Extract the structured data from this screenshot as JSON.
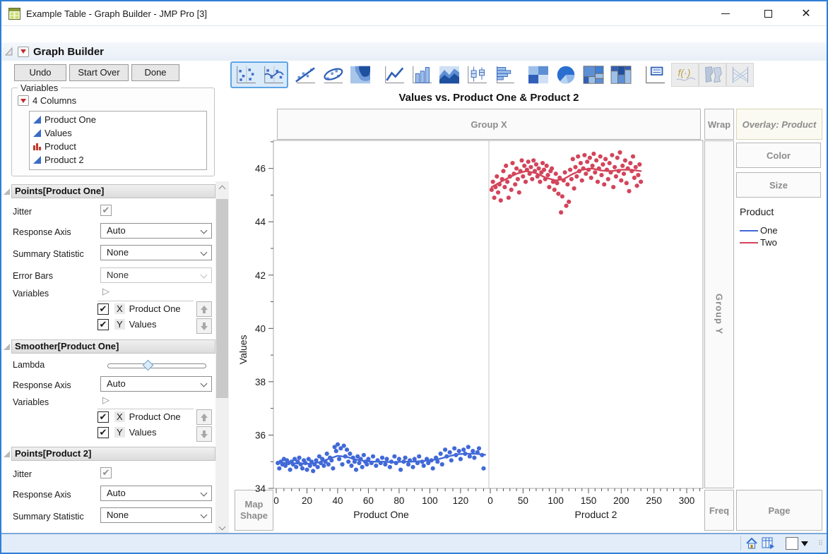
{
  "window": {
    "title": "Example Table - Graph Builder - JMP Pro [3]",
    "controls": [
      "minimize",
      "maximize",
      "close"
    ]
  },
  "header": {
    "title": "Graph Builder",
    "undo": "Undo",
    "start_over": "Start Over",
    "done": "Done"
  },
  "variables_panel": {
    "legend": "Variables",
    "columns_label": "4 Columns",
    "columns": [
      {
        "name": "Product One",
        "type": "continuous"
      },
      {
        "name": "Values",
        "type": "continuous"
      },
      {
        "name": "Product",
        "type": "nominal"
      },
      {
        "name": "Product 2",
        "type": "continuous"
      }
    ]
  },
  "sections": {
    "points_one": {
      "title": "Points[Product One]",
      "jitter_label": "Jitter",
      "response_axis_label": "Response Axis",
      "response_axis_value": "Auto",
      "summary_label": "Summary Statistic",
      "summary_value": "None",
      "error_bars_label": "Error Bars",
      "error_bars_value": "None",
      "variables_label": "Variables",
      "x_role": "X",
      "x_var": "Product One",
      "y_role": "Y",
      "y_var": "Values"
    },
    "smoother_one": {
      "title": "Smoother[Product One]",
      "lambda_label": "Lambda",
      "response_axis_label": "Response Axis",
      "response_axis_value": "Auto",
      "variables_label": "Variables",
      "x_role": "X",
      "x_var": "Product One",
      "y_role": "Y",
      "y_var": "Values"
    },
    "points_two": {
      "title": "Points[Product 2]",
      "jitter_label": "Jitter",
      "response_axis_label": "Response Axis",
      "response_axis_value": "Auto",
      "summary_label": "Summary Statistic",
      "summary_value": "None"
    }
  },
  "toolbar": {
    "icons": [
      {
        "name": "points-icon",
        "selected": true
      },
      {
        "name": "smoother-icon",
        "selected": true
      },
      {
        "name": "line-of-fit-icon"
      },
      {
        "name": "ellipse-icon"
      },
      {
        "name": "contour-icon"
      },
      {
        "name": "line-icon"
      },
      {
        "name": "bar-icon"
      },
      {
        "name": "area-icon"
      },
      {
        "name": "box-plot-icon"
      },
      {
        "name": "histogram-icon"
      },
      {
        "name": "heatmap-icon"
      },
      {
        "name": "pie-icon"
      },
      {
        "name": "treemap-icon"
      },
      {
        "name": "mosaic-icon"
      },
      {
        "name": "caption-box-icon"
      },
      {
        "name": "formula-icon",
        "disabled": true
      },
      {
        "name": "map-shapes-icon",
        "disabled": true
      },
      {
        "name": "parallel-plot-icon",
        "disabled": true
      }
    ]
  },
  "zones": {
    "group_x": "Group X",
    "wrap": "Wrap",
    "overlay": "Overlay: Product",
    "group_y": "Group Y",
    "color": "Color",
    "size": "Size",
    "freq": "Freq",
    "page": "Page",
    "map_shape": "Map Shape"
  },
  "status_bar": {
    "icons": [
      "home-icon",
      "data-table-icon",
      "drop-target-box",
      "dropdown-triangle",
      "resize-grip"
    ]
  },
  "chart_data": {
    "type": "scatter",
    "title": "Values vs. Product One & Product 2",
    "ylabel": "Values",
    "ylim": [
      34,
      47.05
    ],
    "yticks": [
      34,
      36,
      38,
      40,
      42,
      44,
      46
    ],
    "legend": {
      "title": "Product",
      "entries": [
        {
          "label": "One",
          "color": "#4169d8"
        },
        {
          "label": "Two",
          "color": "#d3455b"
        }
      ]
    },
    "panels": [
      {
        "xlabel": "Product One",
        "xlim": [
          0,
          138
        ],
        "xticks": [
          0,
          20,
          40,
          60,
          80,
          100,
          120
        ],
        "minor_step": 5,
        "series": "One",
        "color": "#4169d8",
        "points": [
          [
            1,
            34.95
          ],
          [
            2,
            34.75
          ],
          [
            3,
            35.0
          ],
          [
            4,
            34.9
          ],
          [
            5,
            35.1
          ],
          [
            6,
            34.85
          ],
          [
            7,
            35.05
          ],
          [
            8,
            34.95
          ],
          [
            9,
            34.7
          ],
          [
            10,
            35.0
          ],
          [
            11,
            34.9
          ],
          [
            12,
            35.1
          ],
          [
            13,
            34.8
          ],
          [
            14,
            35.0
          ],
          [
            15,
            35.15
          ],
          [
            16,
            34.9
          ],
          [
            17,
            34.75
          ],
          [
            18,
            35.05
          ],
          [
            19,
            34.95
          ],
          [
            20,
            34.7
          ],
          [
            21,
            35.1
          ],
          [
            22,
            34.85
          ],
          [
            23,
            35.0
          ],
          [
            24,
            34.65
          ],
          [
            25,
            34.9
          ],
          [
            26,
            35.05
          ],
          [
            27,
            34.8
          ],
          [
            28,
            35.2
          ],
          [
            29,
            34.95
          ],
          [
            30,
            35.1
          ],
          [
            31,
            34.85
          ],
          [
            32,
            35.0
          ],
          [
            33,
            35.3
          ],
          [
            34,
            34.9
          ],
          [
            35,
            35.15
          ],
          [
            36,
            35.05
          ],
          [
            37,
            34.75
          ],
          [
            38,
            35.55
          ],
          [
            39,
            35.4
          ],
          [
            40,
            35.65
          ],
          [
            41,
            35.1
          ],
          [
            42,
            35.5
          ],
          [
            43,
            34.9
          ],
          [
            44,
            35.6
          ],
          [
            45,
            35.2
          ],
          [
            46,
            35.45
          ],
          [
            47,
            35.0
          ],
          [
            48,
            35.3
          ],
          [
            49,
            34.85
          ],
          [
            50,
            35.15
          ],
          [
            51,
            35.0
          ],
          [
            52,
            34.7
          ],
          [
            53,
            35.2
          ],
          [
            54,
            34.95
          ],
          [
            55,
            35.1
          ],
          [
            56,
            34.8
          ],
          [
            57,
            35.25
          ],
          [
            58,
            35.0
          ],
          [
            59,
            34.9
          ],
          [
            60,
            35.1
          ],
          [
            62,
            34.95
          ],
          [
            63,
            35.2
          ],
          [
            65,
            34.85
          ],
          [
            66,
            35.05
          ],
          [
            68,
            34.95
          ],
          [
            69,
            35.15
          ],
          [
            71,
            34.9
          ],
          [
            72,
            35.1
          ],
          [
            74,
            34.8
          ],
          [
            75,
            35.0
          ],
          [
            77,
            35.2
          ],
          [
            78,
            34.95
          ],
          [
            80,
            35.1
          ],
          [
            81,
            34.7
          ],
          [
            83,
            35.0
          ],
          [
            84,
            35.15
          ],
          [
            86,
            34.9
          ],
          [
            87,
            35.05
          ],
          [
            89,
            34.8
          ],
          [
            90,
            35.1
          ],
          [
            92,
            34.95
          ],
          [
            93,
            35.2
          ],
          [
            95,
            35.0
          ],
          [
            96,
            34.85
          ],
          [
            98,
            35.1
          ],
          [
            99,
            34.95
          ],
          [
            101,
            35.05
          ],
          [
            102,
            34.75
          ],
          [
            104,
            35.15
          ],
          [
            105,
            35.0
          ],
          [
            107,
            35.3
          ],
          [
            108,
            34.9
          ],
          [
            110,
            35.45
          ],
          [
            111,
            35.2
          ],
          [
            113,
            35.35
          ],
          [
            114,
            35.05
          ],
          [
            116,
            35.5
          ],
          [
            117,
            35.25
          ],
          [
            119,
            35.4
          ],
          [
            120,
            35.1
          ],
          [
            122,
            35.45
          ],
          [
            123,
            35.3
          ],
          [
            125,
            35.55
          ],
          [
            126,
            35.2
          ],
          [
            128,
            35.4
          ],
          [
            129,
            35.15
          ],
          [
            131,
            35.35
          ],
          [
            132,
            35.5
          ],
          [
            134,
            35.25
          ],
          [
            135,
            34.75
          ]
        ],
        "smoother": [
          [
            1,
            34.97
          ],
          [
            8,
            34.95
          ],
          [
            15,
            34.93
          ],
          [
            22,
            34.92
          ],
          [
            28,
            34.98
          ],
          [
            34,
            35.1
          ],
          [
            40,
            35.22
          ],
          [
            46,
            35.18
          ],
          [
            52,
            35.08
          ],
          [
            58,
            35.02
          ],
          [
            64,
            35.0
          ],
          [
            70,
            35.0
          ],
          [
            76,
            34.98
          ],
          [
            82,
            35.0
          ],
          [
            88,
            35.0
          ],
          [
            94,
            35.02
          ],
          [
            100,
            35.05
          ],
          [
            106,
            35.1
          ],
          [
            112,
            35.2
          ],
          [
            118,
            35.28
          ],
          [
            124,
            35.3
          ],
          [
            130,
            35.3
          ],
          [
            136,
            35.26
          ]
        ]
      },
      {
        "xlabel": "Product 2",
        "xlim": [
          0,
          325
        ],
        "xticks": [
          0,
          50,
          100,
          150,
          200,
          250,
          300
        ],
        "minor_step": 10,
        "series": "Two",
        "color": "#d3455b",
        "points": [
          [
            2,
            45.2
          ],
          [
            4,
            45.5
          ],
          [
            6,
            44.9
          ],
          [
            8,
            45.3
          ],
          [
            10,
            45.7
          ],
          [
            12,
            45.1
          ],
          [
            14,
            45.4
          ],
          [
            16,
            44.8
          ],
          [
            18,
            45.6
          ],
          [
            20,
            45.9
          ],
          [
            22,
            45.3
          ],
          [
            24,
            46.1
          ],
          [
            26,
            45.5
          ],
          [
            28,
            44.9
          ],
          [
            30,
            45.7
          ],
          [
            32,
            45.2
          ],
          [
            34,
            46.2
          ],
          [
            36,
            45.8
          ],
          [
            38,
            45.4
          ],
          [
            40,
            46.0
          ],
          [
            42,
            45.6
          ],
          [
            44,
            45.1
          ],
          [
            46,
            45.9
          ],
          [
            48,
            46.3
          ],
          [
            50,
            45.7
          ],
          [
            52,
            46.1
          ],
          [
            54,
            45.5
          ],
          [
            56,
            45.95
          ],
          [
            58,
            46.25
          ],
          [
            60,
            45.8
          ],
          [
            62,
            46.05
          ],
          [
            64,
            45.6
          ],
          [
            66,
            46.3
          ],
          [
            68,
            45.9
          ],
          [
            70,
            46.15
          ],
          [
            72,
            45.7
          ],
          [
            74,
            46.0
          ],
          [
            76,
            45.5
          ],
          [
            78,
            45.85
          ],
          [
            80,
            46.2
          ],
          [
            82,
            45.95
          ],
          [
            84,
            45.6
          ],
          [
            86,
            46.1
          ],
          [
            88,
            45.75
          ],
          [
            90,
            45.3
          ],
          [
            92,
            45.9
          ],
          [
            94,
            46.0
          ],
          [
            96,
            45.5
          ],
          [
            98,
            45.2
          ],
          [
            100,
            45.8
          ],
          [
            102,
            45.45
          ],
          [
            104,
            45.05
          ],
          [
            106,
            45.65
          ],
          [
            108,
            44.35
          ],
          [
            110,
            44.95
          ],
          [
            112,
            45.55
          ],
          [
            114,
            45.85
          ],
          [
            116,
            44.6
          ],
          [
            118,
            45.4
          ],
          [
            120,
            44.75
          ],
          [
            122,
            45.95
          ],
          [
            124,
            45.6
          ],
          [
            126,
            46.35
          ],
          [
            128,
            45.25
          ],
          [
            130,
            46.05
          ],
          [
            132,
            45.7
          ],
          [
            134,
            46.45
          ],
          [
            136,
            45.9
          ],
          [
            138,
            46.2
          ],
          [
            140,
            45.55
          ],
          [
            142,
            46.0
          ],
          [
            144,
            46.5
          ],
          [
            146,
            45.8
          ],
          [
            148,
            46.25
          ],
          [
            150,
            45.95
          ],
          [
            152,
            46.4
          ],
          [
            154,
            45.65
          ],
          [
            156,
            46.1
          ],
          [
            158,
            46.55
          ],
          [
            160,
            45.85
          ],
          [
            162,
            46.3
          ],
          [
            164,
            45.5
          ],
          [
            166,
            46.0
          ],
          [
            168,
            46.45
          ],
          [
            170,
            45.75
          ],
          [
            172,
            46.15
          ],
          [
            174,
            45.4
          ],
          [
            176,
            46.35
          ],
          [
            178,
            45.95
          ],
          [
            180,
            45.6
          ],
          [
            182,
            46.2
          ],
          [
            184,
            45.85
          ],
          [
            186,
            46.5
          ],
          [
            188,
            45.3
          ],
          [
            190,
            46.05
          ],
          [
            192,
            45.7
          ],
          [
            194,
            46.4
          ],
          [
            196,
            45.9
          ],
          [
            198,
            46.6
          ],
          [
            200,
            45.55
          ],
          [
            202,
            46.1
          ],
          [
            204,
            45.8
          ],
          [
            206,
            46.3
          ],
          [
            208,
            45.45
          ],
          [
            210,
            46.0
          ],
          [
            212,
            45.15
          ],
          [
            214,
            46.2
          ],
          [
            216,
            45.9
          ],
          [
            218,
            46.45
          ],
          [
            220,
            45.65
          ],
          [
            222,
            46.05
          ],
          [
            224,
            45.35
          ],
          [
            226,
            45.75
          ],
          [
            228,
            46.15
          ],
          [
            230,
            45.5
          ]
        ],
        "smoother": [
          [
            2,
            45.3
          ],
          [
            20,
            45.55
          ],
          [
            40,
            45.8
          ],
          [
            55,
            45.9
          ],
          [
            70,
            45.82
          ],
          [
            85,
            45.65
          ],
          [
            100,
            45.55
          ],
          [
            112,
            45.6
          ],
          [
            125,
            45.78
          ],
          [
            140,
            45.95
          ],
          [
            155,
            46.0
          ],
          [
            170,
            45.92
          ],
          [
            185,
            45.9
          ],
          [
            200,
            45.95
          ],
          [
            215,
            45.95
          ],
          [
            230,
            45.9
          ]
        ]
      }
    ]
  }
}
